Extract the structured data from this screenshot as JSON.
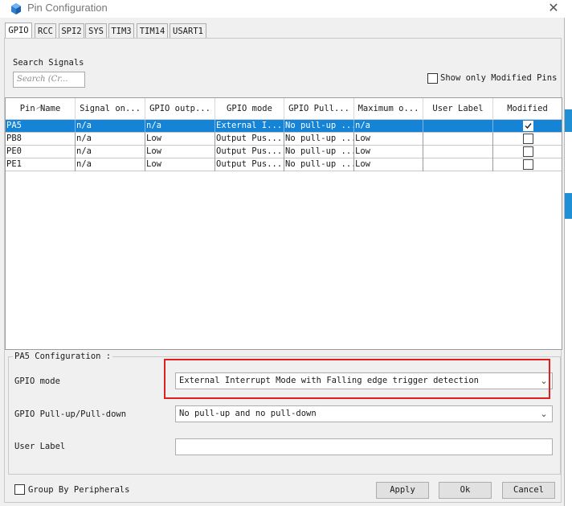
{
  "window": {
    "title": "Pin Configuration",
    "close_glyph": "✕",
    "icon": "cube-icon"
  },
  "tabs": [
    {
      "label": "GPIO",
      "active": true
    },
    {
      "label": "RCC"
    },
    {
      "label": "SPI2"
    },
    {
      "label": "SYS"
    },
    {
      "label": "TIM3"
    },
    {
      "label": "TIM14"
    },
    {
      "label": "USART1"
    }
  ],
  "search": {
    "label": "Search Signals",
    "placeholder": "Search (Cr..."
  },
  "filter": {
    "label": "Show only Modified Pins",
    "checked": false
  },
  "table": {
    "columns": [
      "Pin Name",
      "Signal on...",
      "GPIO outp...",
      "GPIO mode",
      "GPIO Pull...",
      "Maximum o...",
      "User Label",
      "Modified"
    ],
    "rows": [
      {
        "pin": "PA5",
        "signal": "n/a",
        "output": "n/a",
        "mode": "External I...",
        "pull": "No pull-up ...",
        "max": "n/a",
        "label": "",
        "modified": true,
        "selected": true
      },
      {
        "pin": "PB8",
        "signal": "n/a",
        "output": "Low",
        "mode": "Output Pus...",
        "pull": "No pull-up ...",
        "max": "Low",
        "label": "",
        "modified": false
      },
      {
        "pin": "PE0",
        "signal": "n/a",
        "output": "Low",
        "mode": "Output Pus...",
        "pull": "No pull-up ...",
        "max": "Low",
        "label": "",
        "modified": false
      },
      {
        "pin": "PE1",
        "signal": "n/a",
        "output": "Low",
        "mode": "Output Pus...",
        "pull": "No pull-up ...",
        "max": "Low",
        "label": "",
        "modified": false
      }
    ]
  },
  "config": {
    "title": "PA5 Configuration :",
    "gpio_mode_label": "GPIO mode",
    "gpio_mode_value": "External Interrupt Mode with Falling edge trigger detection",
    "pull_label": "GPIO Pull-up/Pull-down",
    "pull_value": "No pull-up and no pull-down",
    "user_label_label": "User Label",
    "user_label_value": ""
  },
  "footer": {
    "group_label": "Group By Peripherals",
    "group_checked": false,
    "apply": "Apply",
    "ok": "Ok",
    "cancel": "Cancel"
  },
  "colors": {
    "selection": "#1583d6",
    "highlight_box": "#e02020"
  }
}
